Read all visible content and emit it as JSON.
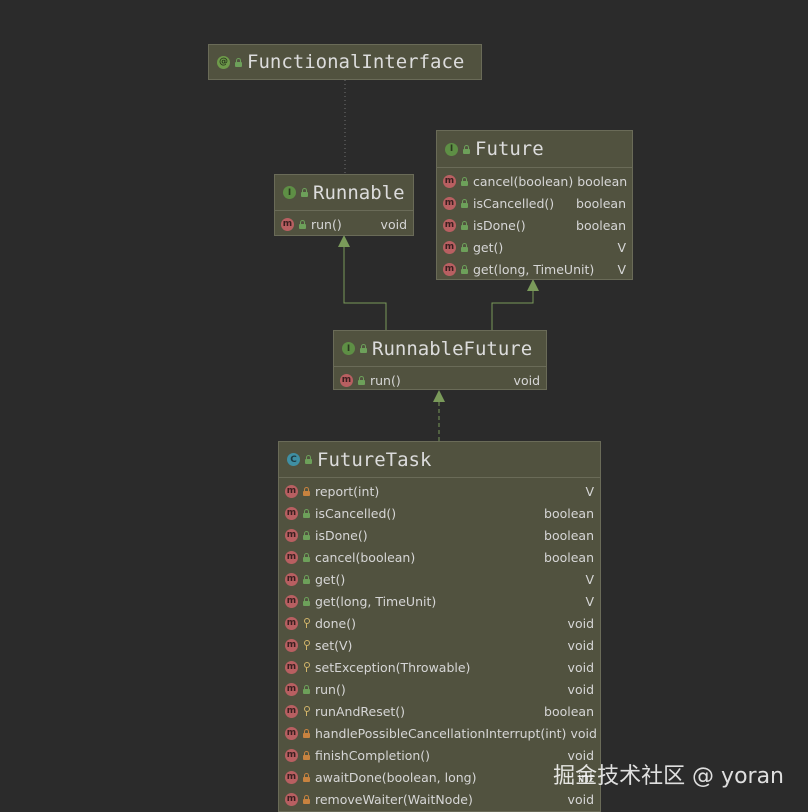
{
  "nodes": {
    "functional_interface": {
      "title": "FunctionalInterface",
      "kind": "@"
    },
    "runnable": {
      "title": "Runnable",
      "kind": "I",
      "methods": [
        {
          "name": "run()",
          "type": "void"
        }
      ]
    },
    "future": {
      "title": "Future",
      "kind": "I",
      "methods": [
        {
          "name": "cancel(boolean)",
          "type": "boolean"
        },
        {
          "name": "isCancelled()",
          "type": "boolean"
        },
        {
          "name": "isDone()",
          "type": "boolean"
        },
        {
          "name": "get()",
          "type": "V"
        },
        {
          "name": "get(long, TimeUnit)",
          "type": "V"
        }
      ]
    },
    "runnable_future": {
      "title": "RunnableFuture",
      "kind": "I",
      "methods": [
        {
          "name": "run()",
          "type": "void"
        }
      ]
    },
    "future_task": {
      "title": "FutureTask",
      "kind": "C",
      "methods": [
        {
          "name": "report(int)",
          "type": "V"
        },
        {
          "name": "isCancelled()",
          "type": "boolean"
        },
        {
          "name": "isDone()",
          "type": "boolean"
        },
        {
          "name": "cancel(boolean)",
          "type": "boolean"
        },
        {
          "name": "get()",
          "type": "V"
        },
        {
          "name": "get(long, TimeUnit)",
          "type": "V"
        },
        {
          "name": "done()",
          "type": "void"
        },
        {
          "name": "set(V)",
          "type": "void"
        },
        {
          "name": "setException(Throwable)",
          "type": "void"
        },
        {
          "name": "run()",
          "type": "void"
        },
        {
          "name": "runAndReset()",
          "type": "boolean"
        },
        {
          "name": "handlePossibleCancellationInterrupt(int)",
          "type": "void"
        },
        {
          "name": "finishCompletion()",
          "type": "void"
        },
        {
          "name": "awaitDone(boolean, long)",
          "type": "int"
        },
        {
          "name": "removeWaiter(WaitNode)",
          "type": "void"
        }
      ]
    }
  },
  "method_icon_letter": "m",
  "watermark": "掘金技术社区 @ yoran",
  "colors": {
    "background": "#2b2b2b",
    "node_fill": "#51523f",
    "edge": "#7a9a5a",
    "method_icon": "#b85f61"
  }
}
